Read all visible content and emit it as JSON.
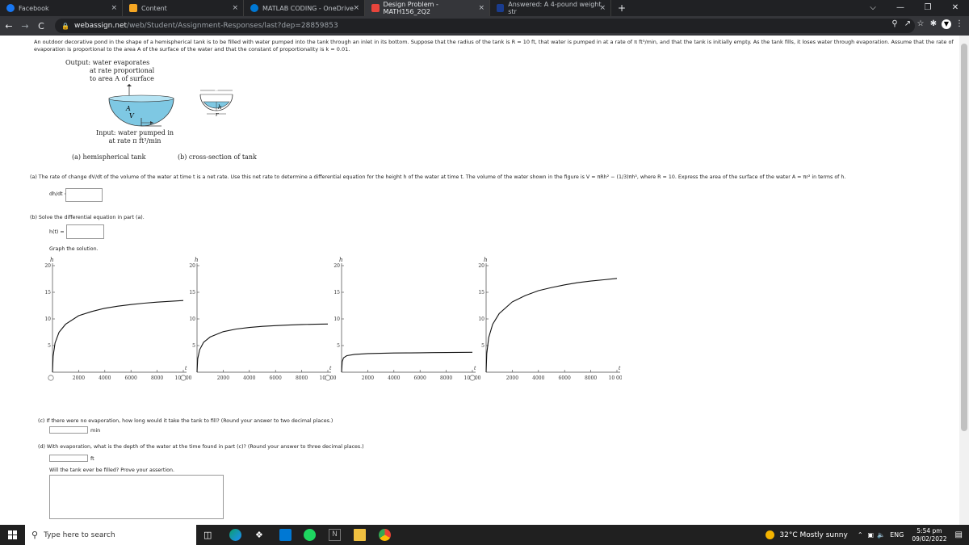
{
  "tabs": [
    {
      "label": "Facebook",
      "color": "#1877f2",
      "close": "×"
    },
    {
      "label": "Content",
      "color": "#f5a623",
      "close": "×"
    },
    {
      "label": "MATLAB CODING - OneDrive",
      "color": "#0078d4",
      "close": "×"
    },
    {
      "label": "Design Problem - MATH156_2Q2",
      "color": "#e8453c",
      "close": "×"
    },
    {
      "label": "Answered: A 4-pound weight str",
      "color": "#1a3c8f",
      "close": "×"
    }
  ],
  "new_tab": "+",
  "window_controls": {
    "minimize": "—",
    "restore": "❐",
    "close": "✕",
    "dropdown": "⌵"
  },
  "nav": {
    "back": "←",
    "forward": "→",
    "reload": "C"
  },
  "address": {
    "host": "webassign.net",
    "path": "/web/Student/Assignment-Responses/last?dep=28859853"
  },
  "problem": {
    "intro": "An outdoor decorative pond in the shape of a hemispherical tank is to be filled with water pumped into the tank through an inlet in its bottom. Suppose that the radius of the tank is R = 10 ft, that water is pumped in at a rate of π ft³/min, and that the tank is initially empty. As the tank fills, it loses water through evaporation. Assume that the rate of evaporation is proportional to the area A of the surface of the water and that the constant of proportionality is k = 0.01.",
    "figure": {
      "output_l1": "Output: water evaporates",
      "output_l2": "at rate proportional",
      "output_l3": "to area A of surface",
      "input_l1": "Input: water pumped in",
      "input_l2": "at rate π ft³/min",
      "label_A": "A",
      "label_V": "V",
      "label_R": "R",
      "label_h": "h",
      "label_r": "r",
      "cap_a": "(a) hemispherical tank",
      "cap_b": "(b) cross-section of tank"
    },
    "part_a": "(a)  The rate of change dV/dt of the volume of the water at time t is a net rate. Use this net rate to determine a differential equation for the height h of the water at time t. The volume of the water shown in the figure is V = πRh² − (1/3)πh³, where R = 10. Express the area of the surface of the water A = πr² in terms of h.",
    "dhdt_label": "dh/dt =",
    "part_b": "(b)  Solve the differential equation in part (a).",
    "ht_label": "h(t) =",
    "graph_prompt": "Graph the solution.",
    "part_c": "(c)  If there were no evaporation, how long would it take the tank to fill? (Round your answer to two decimal places.)",
    "unit_min": "min",
    "part_d": "(d)  With evaporation, what is the depth of the water at the time found in part (c)? (Round your answer to three decimal places.)",
    "unit_ft": "ft",
    "assert_prompt": "Will the tank ever be filled? Prove your assertion."
  },
  "chart_data": [
    {
      "type": "line",
      "xlabel": "t",
      "ylabel": "h",
      "xlim": [
        0,
        10000
      ],
      "ylim": [
        0,
        20
      ],
      "x_ticks": [
        "2000",
        "4000",
        "6000",
        "8000",
        "10 000"
      ],
      "y_ticks": [
        "5",
        "10",
        "15",
        "20"
      ],
      "series": [
        {
          "x": [
            0,
            50,
            200,
            500,
            1000,
            2000,
            3000,
            4000,
            5000,
            6000,
            7000,
            8000,
            9000,
            10000
          ],
          "y": [
            0,
            3,
            5.5,
            7.5,
            9,
            10.6,
            11.4,
            12,
            12.4,
            12.7,
            12.95,
            13.15,
            13.3,
            13.45
          ]
        }
      ]
    },
    {
      "type": "line",
      "xlabel": "t",
      "ylabel": "h",
      "xlim": [
        0,
        10000
      ],
      "ylim": [
        0,
        20
      ],
      "x_ticks": [
        "2000",
        "4000",
        "6000",
        "8000",
        "10 000"
      ],
      "y_ticks": [
        "5",
        "10",
        "15",
        "20"
      ],
      "series": [
        {
          "x": [
            0,
            50,
            200,
            500,
            1000,
            2000,
            3000,
            4000,
            5000,
            6000,
            7000,
            8000,
            9000,
            10000
          ],
          "y": [
            0,
            2.5,
            4.2,
            5.6,
            6.6,
            7.6,
            8.1,
            8.4,
            8.6,
            8.75,
            8.85,
            8.95,
            9,
            9.05
          ]
        }
      ]
    },
    {
      "type": "line",
      "xlabel": "t",
      "ylabel": "h",
      "xlim": [
        0,
        10000
      ],
      "ylim": [
        0,
        20
      ],
      "x_ticks": [
        "2000",
        "4000",
        "6000",
        "8000",
        "10 000"
      ],
      "y_ticks": [
        "5",
        "10",
        "15",
        "20"
      ],
      "series": [
        {
          "x": [
            0,
            50,
            150,
            400,
            1000,
            2000,
            3000,
            4000,
            5000,
            6000,
            7000,
            8000,
            9000,
            10000
          ],
          "y": [
            0,
            2,
            2.7,
            3.1,
            3.35,
            3.5,
            3.55,
            3.6,
            3.62,
            3.65,
            3.68,
            3.7,
            3.72,
            3.75
          ]
        }
      ]
    },
    {
      "type": "line",
      "xlabel": "t",
      "ylabel": "h",
      "xlim": [
        0,
        10000
      ],
      "ylim": [
        0,
        20
      ],
      "x_ticks": [
        "2000",
        "4000",
        "6000",
        "8000",
        "10 000"
      ],
      "y_ticks": [
        "5",
        "10",
        "15",
        "20"
      ],
      "series": [
        {
          "x": [
            0,
            50,
            200,
            500,
            1000,
            2000,
            3000,
            4000,
            5000,
            6000,
            7000,
            8000,
            9000,
            10000
          ],
          "y": [
            0,
            3.5,
            6.5,
            9,
            11,
            13.2,
            14.4,
            15.3,
            15.9,
            16.4,
            16.8,
            17.1,
            17.35,
            17.6
          ]
        }
      ]
    }
  ],
  "taskbar": {
    "search_placeholder": "Type here to search",
    "weather": "32°C  Mostly sunny",
    "lang": "ENG",
    "time": "5:54 pm",
    "date": "09/02/2022"
  }
}
